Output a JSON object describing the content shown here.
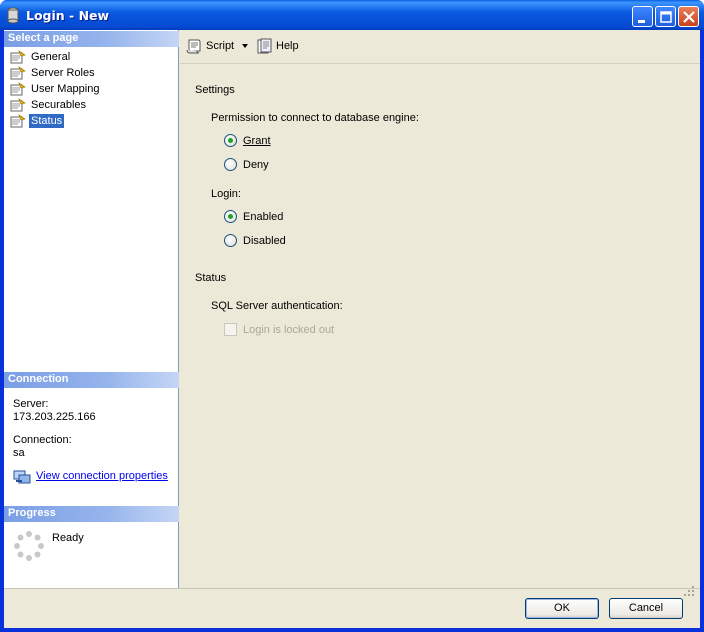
{
  "window": {
    "title": "Login - New"
  },
  "left": {
    "select_page_header": "Select a page",
    "pages": [
      {
        "label": "General"
      },
      {
        "label": "Server Roles"
      },
      {
        "label": "User Mapping"
      },
      {
        "label": "Securables"
      },
      {
        "label": "Status",
        "selected": true
      }
    ],
    "connection_header": "Connection",
    "server_label": "Server:",
    "server_value": "173.203.225.166",
    "connection_label": "Connection:",
    "connection_value": "sa",
    "view_link": "View connection properties",
    "progress_header": "Progress",
    "progress_status": "Ready"
  },
  "toolbar": {
    "script_label": "Script",
    "help_label": "Help"
  },
  "content": {
    "settings_heading": "Settings",
    "permission_label": "Permission to connect to database engine:",
    "grant_label": "Grant",
    "deny_label": "Deny",
    "permission_selected": "Grant",
    "login_label": "Login:",
    "enabled_label": "Enabled",
    "disabled_label": "Disabled",
    "login_selected": "Enabled",
    "status_heading": "Status",
    "sql_auth_label": "SQL Server authentication:",
    "locked_out_label": "Login is locked out",
    "locked_out_checked": false
  },
  "footer": {
    "ok_label": "OK",
    "cancel_label": "Cancel"
  },
  "colors": {
    "title_bar": "#0a5ae0",
    "section_header": "#7a9ee5",
    "selection": "#316ac5",
    "dialog_background": "#ece9d8"
  }
}
